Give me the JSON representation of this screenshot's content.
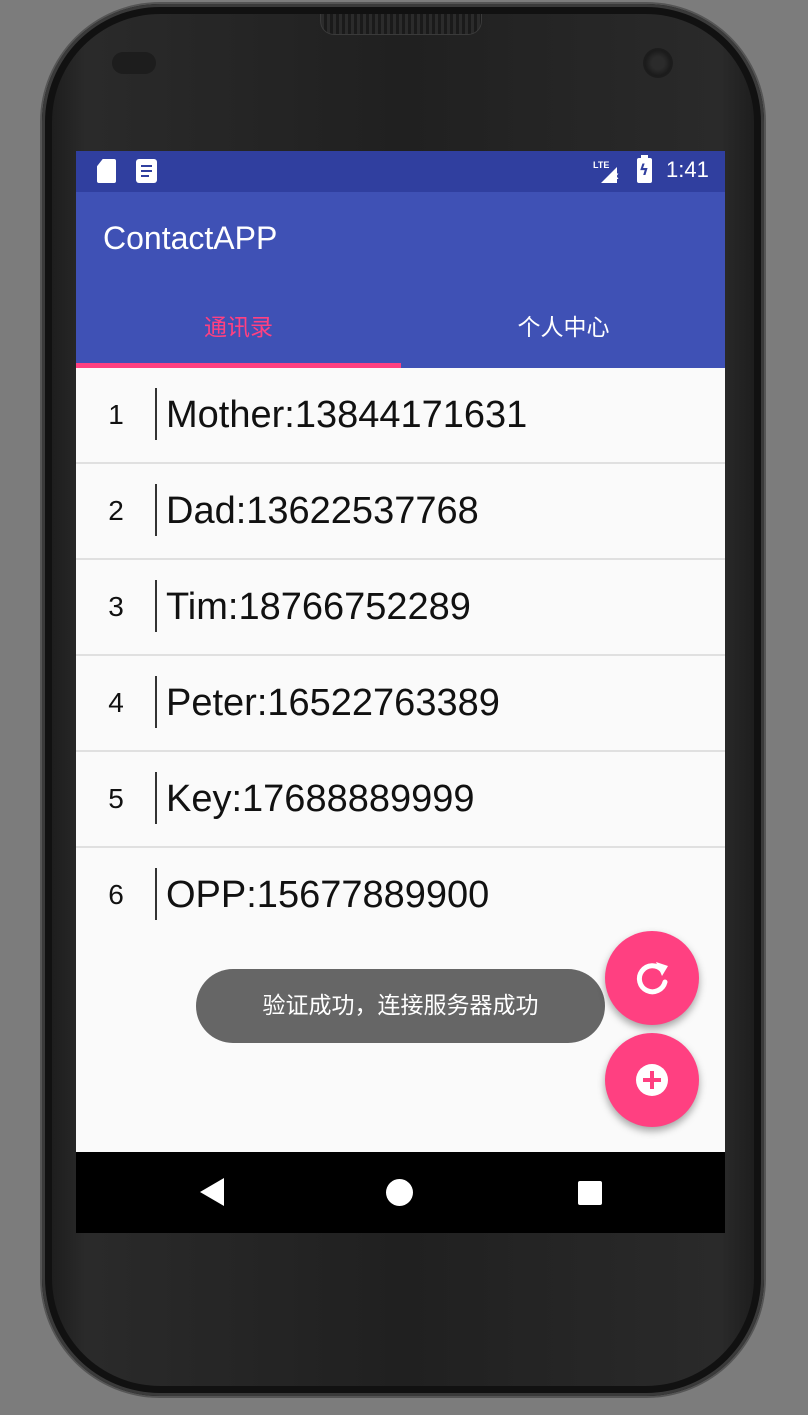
{
  "status_bar": {
    "time": "1:41",
    "lte_label": "LTE",
    "lte_x": "x",
    "icons": [
      "sd-card-icon",
      "notification-note-icon",
      "lte-signal-icon",
      "battery-charging-icon"
    ]
  },
  "app_bar": {
    "title": "ContactAPP"
  },
  "tabs": [
    {
      "label": "通讯录",
      "selected": true
    },
    {
      "label": "个人中心",
      "selected": false
    }
  ],
  "contacts": [
    {
      "index": "1",
      "text": "Mother:13844171631"
    },
    {
      "index": "2",
      "text": "Dad:13622537768"
    },
    {
      "index": "3",
      "text": "Tim:18766752289"
    },
    {
      "index": "4",
      "text": "Peter:16522763389"
    },
    {
      "index": "5",
      "text": "Key:17688889999"
    },
    {
      "index": "6",
      "text": "OPP:15677889900"
    }
  ],
  "toast": {
    "message": "验证成功，连接服务器成功"
  },
  "fabs": {
    "refresh_icon": "refresh-icon",
    "add_icon": "add-circle-icon"
  },
  "colors": {
    "primary": "#3f51b5",
    "primary_dark": "#303f9f",
    "accent": "#ff4081"
  }
}
